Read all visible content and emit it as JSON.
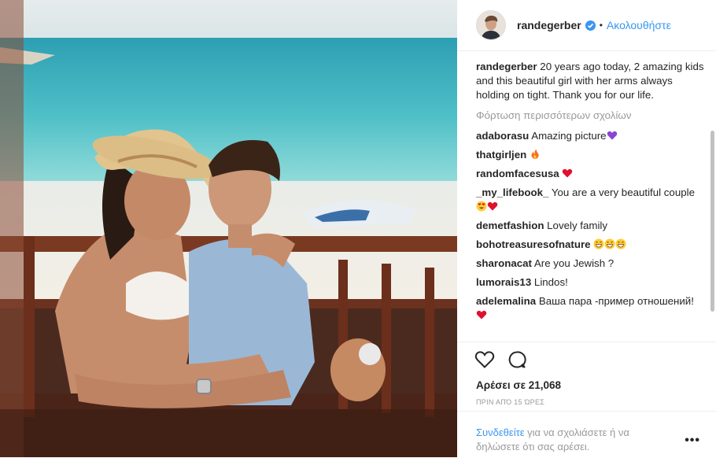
{
  "header": {
    "username": "randegerber",
    "separator": "•",
    "follow_label": "Ακολουθήστε"
  },
  "caption": {
    "username": "randegerber",
    "text": "20 years ago today, 2 amazing kids and this beautiful girl with her arms always holding on tight. Thank you for our life."
  },
  "load_more_label": "Φόρτωση περισσότερων σχολίων",
  "comments": [
    {
      "username": "adaborasu",
      "text": "Amazing picture",
      "emoji": [
        "purple-heart"
      ]
    },
    {
      "username": "thatgirljen",
      "text": "",
      "emoji": [
        "fire"
      ]
    },
    {
      "username": "randomfacesusa",
      "text": "",
      "emoji": [
        "red-heart"
      ]
    },
    {
      "username": "_my_lifebook_",
      "text": "You are a very beautiful couple",
      "emoji": [
        "heart-eyes",
        "red-heart"
      ]
    },
    {
      "username": "demetfashion",
      "text": "Lovely family",
      "emoji": []
    },
    {
      "username": "bohotreasuresofnature",
      "text": "",
      "emoji": [
        "grin",
        "grin",
        "grin"
      ]
    },
    {
      "username": "sharonacat",
      "text": "Are you Jewish ?",
      "emoji": []
    },
    {
      "username": "lumorais13",
      "text": "Lindos!",
      "emoji": []
    },
    {
      "username": "adelemalina",
      "text": "Ваша пара -пример отношений!",
      "emoji": [
        "red-heart"
      ]
    }
  ],
  "likes_label": "Αρέσει σε 21,068",
  "time_label": "ΠΡΙΝ ΑΠΌ 15 ΏΡΕΣ",
  "footer": {
    "login_link": "Συνδεθείτε",
    "login_text": "για να σχολιάσετε ή να δηλώσετε ότι σας αρέσει.",
    "more_label": "•••"
  },
  "colors": {
    "link_blue": "#3897f0",
    "text": "#262626",
    "muted": "#999999",
    "verified_badge": "#3897f0"
  },
  "icons": [
    "heart-outline-icon",
    "comment-bubble-icon",
    "verified-badge-icon",
    "more-options-icon"
  ]
}
